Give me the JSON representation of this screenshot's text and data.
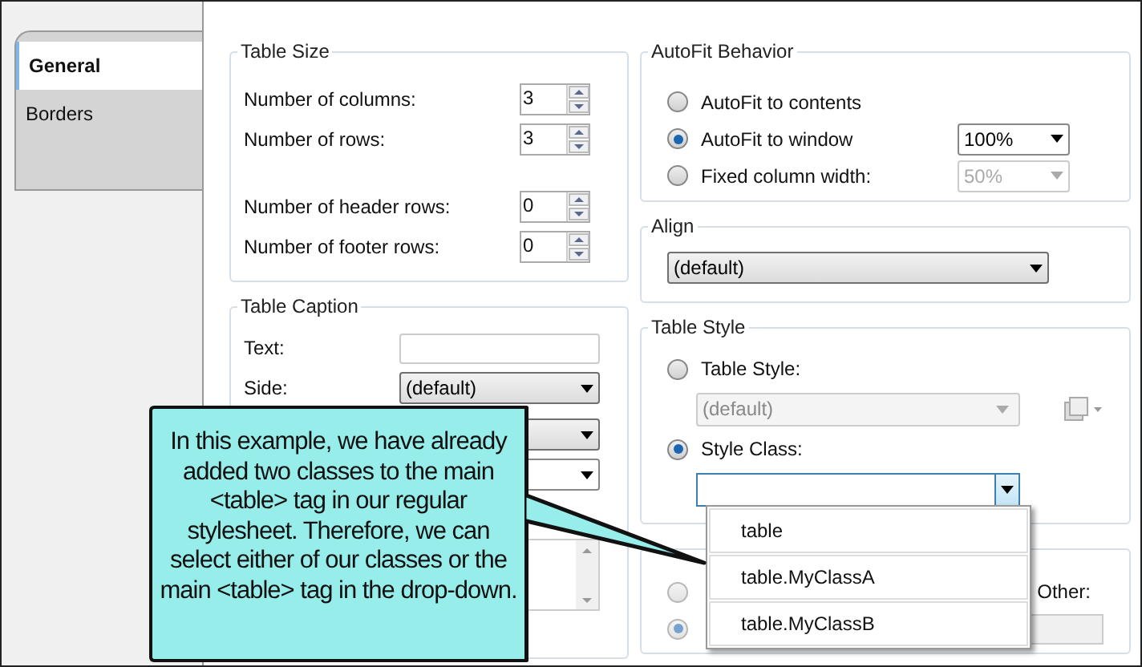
{
  "tabs": [
    {
      "label": "General",
      "selected": true
    },
    {
      "label": "Borders",
      "selected": false
    }
  ],
  "table_size": {
    "title": "Table Size",
    "fields": [
      {
        "label": "Number of columns:",
        "value": "3"
      },
      {
        "label": "Number of rows:",
        "value": "3"
      },
      {
        "label": "Number of header rows:",
        "value": "0"
      },
      {
        "label": "Number of footer rows:",
        "value": "0"
      }
    ]
  },
  "table_caption": {
    "title": "Table Caption",
    "text_label": "Text:",
    "side_label": "Side:",
    "side_value": "(default)"
  },
  "autofit": {
    "title": "AutoFit Behavior",
    "options": [
      {
        "label": "AutoFit to contents",
        "selected": false
      },
      {
        "label": "AutoFit to window",
        "selected": true,
        "value": "100%",
        "disabled": false
      },
      {
        "label": "Fixed column width:",
        "selected": false,
        "value": "50%",
        "disabled": true
      }
    ]
  },
  "align": {
    "title": "Align",
    "value": "(default)"
  },
  "table_style": {
    "title": "Table Style",
    "options": [
      {
        "label": "Table Style:",
        "selected": false,
        "value": "(default)"
      },
      {
        "label": "Style Class:",
        "selected": true
      }
    ]
  },
  "text_group": {
    "other_label": "Other:",
    "left_radios": [
      {
        "selected": false
      },
      {
        "selected": true
      }
    ]
  },
  "style_class_dropdown": {
    "items": [
      "table",
      "table.MyClassA",
      "table.MyClassB"
    ]
  },
  "callout": {
    "text": "In this example, we have already added two classes to the main <table> tag in our regular stylesheet. Therefore, we can select either of our classes or the main <table> tag in the drop-down."
  }
}
